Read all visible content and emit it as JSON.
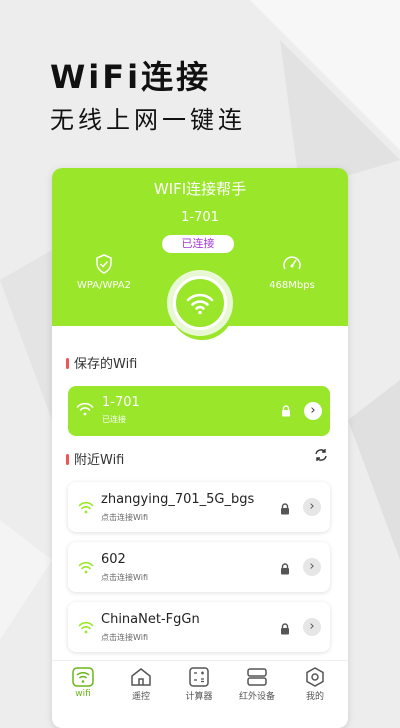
{
  "promo": {
    "title": "WiFi连接",
    "subtitle": "无线上网一键连"
  },
  "app": {
    "title": "WIFI连接帮手",
    "current_ssid": "1-701",
    "status": "已连接",
    "security_label": "WPA/WPA2",
    "speed_label": "468Mbps"
  },
  "saved": {
    "heading": "保存的Wifi",
    "network": {
      "name": "1-701",
      "status": "已连接"
    }
  },
  "nearby": {
    "heading": "附近Wifi",
    "networks": [
      {
        "name": "zhangying_701_5G_bgs",
        "hint": "点击连接Wifi"
      },
      {
        "name": "602",
        "hint": "点击连接Wifi"
      },
      {
        "name": "ChinaNet-FgGn",
        "hint": "点击连接Wifi"
      }
    ]
  },
  "tabs": [
    {
      "label": "wifi",
      "icon": "wifi-icon"
    },
    {
      "label": "遥控",
      "icon": "home-icon"
    },
    {
      "label": "计算器",
      "icon": "calculator-icon"
    },
    {
      "label": "红外设备",
      "icon": "infrared-device-icon"
    },
    {
      "label": "我的",
      "icon": "profile-hexagon-icon"
    }
  ],
  "colors": {
    "accent": "#9ae62b",
    "status_text": "#a63ad9",
    "active_tab": "#6cb51a"
  }
}
